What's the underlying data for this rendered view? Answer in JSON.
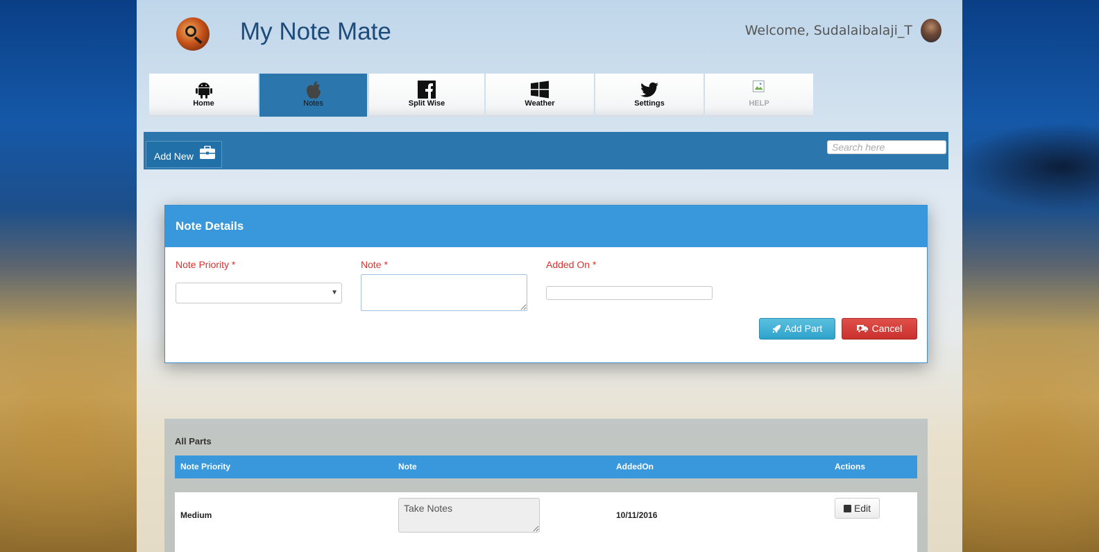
{
  "header": {
    "app_title": "My Note Mate",
    "welcome": "Welcome, Sudalaibalaji_T"
  },
  "nav": {
    "tabs": [
      {
        "label": "Home",
        "icon": "android-icon",
        "active": false
      },
      {
        "label": "Notes",
        "icon": "apple-icon",
        "active": true
      },
      {
        "label": "Split Wise",
        "icon": "facebook-icon",
        "active": false
      },
      {
        "label": "Weather",
        "icon": "windows-icon",
        "active": false
      },
      {
        "label": "Settings",
        "icon": "twitter-icon",
        "active": false
      },
      {
        "label": "HELP",
        "icon": "broken-image-icon",
        "active": false
      }
    ]
  },
  "toolbar": {
    "add_new_label": "Add New",
    "search_placeholder": "Search here"
  },
  "form": {
    "title": "Note Details",
    "priority_label": "Note Priority *",
    "priority_value": "",
    "note_label": "Note *",
    "note_value": "",
    "added_on_label": "Added On *",
    "added_on_value": "",
    "add_button": "Add Part",
    "cancel_button": "Cancel"
  },
  "parts": {
    "title": "All Parts",
    "columns": [
      "Note Priority",
      "Note",
      "AddedOn",
      "Actions"
    ],
    "rows": [
      {
        "priority": "Medium",
        "note": "Take Notes",
        "added_on": "10/11/2016",
        "action": "Edit"
      }
    ]
  },
  "colors": {
    "accent": "#3898db",
    "nav_active": "#2a76ad",
    "required": "#d9312e",
    "danger": "#c9302c",
    "info": "#2fa3cb"
  }
}
